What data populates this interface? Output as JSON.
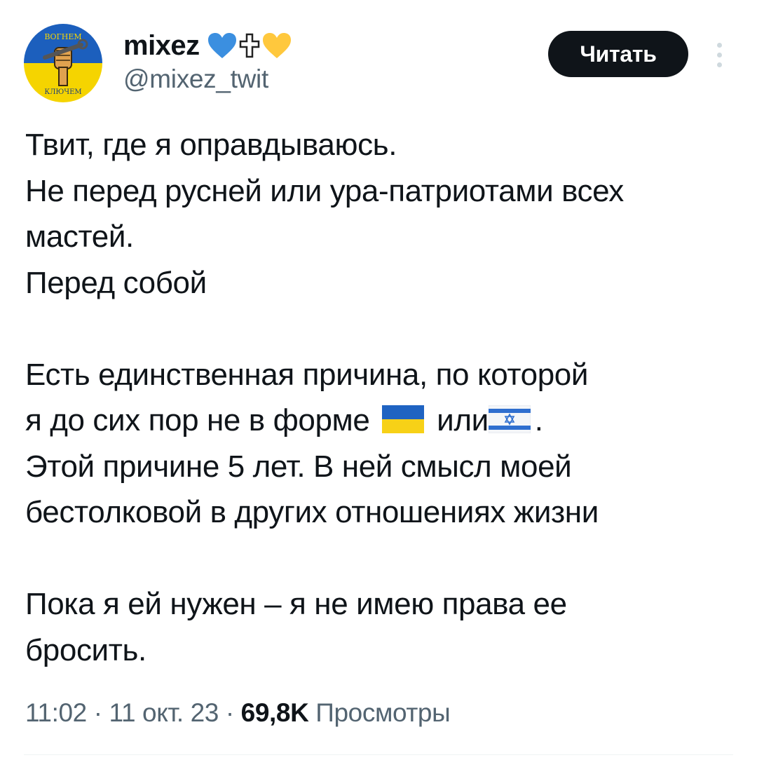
{
  "author": {
    "display_name": "mixez",
    "name_emojis": [
      "blue-heart",
      "cross",
      "yellow-heart"
    ],
    "handle": "@mixez_twit",
    "avatar": {
      "top_text": "ВОГНЕМ",
      "bottom_text": "КЛЮЧЕМ",
      "colors": {
        "top": "#1c5fbd",
        "bottom": "#f5d400"
      }
    }
  },
  "follow_button": {
    "label": "Читать"
  },
  "tweet": {
    "paragraphs": [
      [
        "Твит, где я оправдываюсь.",
        "Не перед русней или ура-патриотами всех",
        "мастей.",
        "Перед собой"
      ],
      [
        "Есть единственная причина, по которой",
        "я до сих пор не в форме",
        "или",
        ".",
        "Этой причине 5 лет. В ней смысл моей",
        "бестолковой в других отношениях жизни"
      ],
      [
        "Пока я ей нужен – я не имею права ее",
        "бросить."
      ]
    ]
  },
  "meta": {
    "time": "11:02",
    "separator": " · ",
    "date": "11 окт. 23",
    "views_count": "69,8K",
    "views_label": "Просмотры"
  },
  "colors": {
    "text": "#0f1419",
    "secondary": "#536471",
    "heart_blue": "#3b8fe0",
    "heart_yellow": "#ffc83d",
    "flag_blue": "#1f63c2",
    "flag_yellow": "#f7d117"
  }
}
